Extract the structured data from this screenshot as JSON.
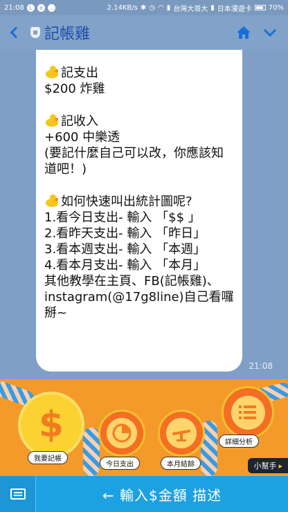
{
  "status_bar": {
    "time": "21:08",
    "speed": "2.14KB/s",
    "carrier1": "台灣大哥大",
    "carrier2": "日本漫遊卡",
    "battery": "70%"
  },
  "header": {
    "title": "記帳雞",
    "back_icon": "chevron-left-icon",
    "home_icon": "home-icon",
    "menu_icon": "chevron-down-icon"
  },
  "message": {
    "sections": [
      {
        "text": "記支出\n$200 炸雞"
      },
      {
        "text": "記收入\n+600 中樂透\n(要記什麼自己可以改，你應該知道吧！)"
      },
      {
        "text": "如何快速叫出統計圖呢?\n1.看今日支出- 輸入 「$$ 」\n2.看昨天支出- 輸入 「昨日」\n3.看本週支出- 輸入 「本週」\n4.看本月支出- 輸入 「本月」\n其他教學在主頁、FB(記帳雞)、instagram(@17g8line)自己看囉掰~"
      }
    ],
    "time": "21:08"
  },
  "rich_menu": {
    "items": [
      {
        "label": "我要記帳",
        "symbol": "$"
      },
      {
        "label": "今日支出",
        "symbol": ""
      },
      {
        "label": "本月結餘",
        "symbol": ""
      },
      {
        "label": "詳細分析",
        "symbol": ""
      }
    ],
    "help_tab": "小幫手",
    "help_arrow": "▸"
  },
  "bottom_bar": {
    "label": "← 輸入$金額 描述"
  },
  "colors": {
    "accent": "#1da1e2",
    "title_blue": "#1b4fa8",
    "menu_orange": "#f39a2b"
  }
}
